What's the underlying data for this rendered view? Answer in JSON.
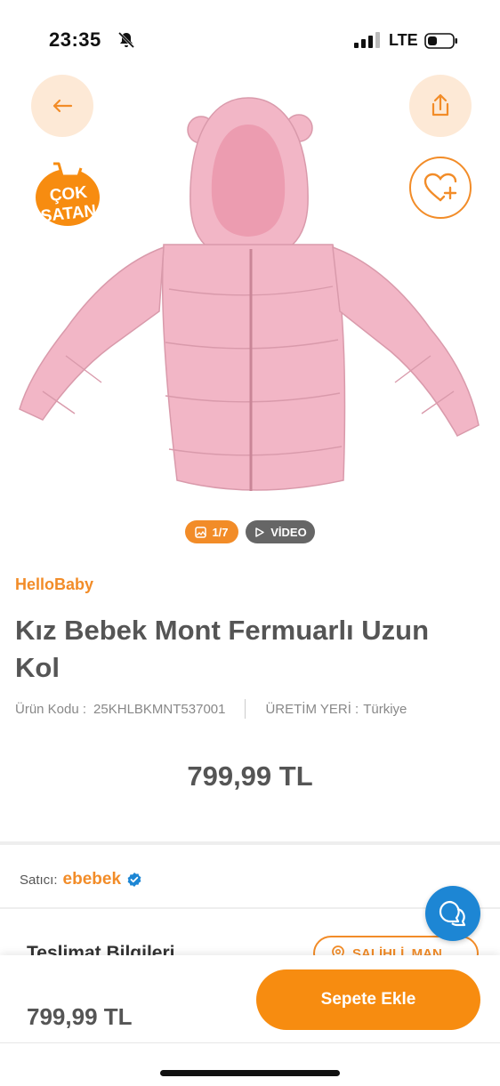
{
  "status_bar": {
    "time": "23:35",
    "network": "LTE"
  },
  "product": {
    "badge_line1": "ÇOK",
    "badge_line2": "SATAN",
    "gallery_counter": "1/7",
    "video_label": "VİDEO",
    "brand": "HelloBaby",
    "title": "Kız Bebek Mont Fermuarlı Uzun Kol",
    "code_label": "Ürün Kodu :",
    "code_value": "25KHLBKMNT537001",
    "origin_label": "ÜRETİM YERİ :",
    "origin_value": "Türkiye",
    "price": "799,99 TL",
    "jacket_color": "#f2b6c6"
  },
  "seller": {
    "label": "Satıcı:",
    "name": "ebebek"
  },
  "delivery": {
    "title": "Teslimat Bilgileri",
    "location": "SALİHLİ, MAN..."
  },
  "bottom_bar": {
    "price": "799,99 TL",
    "add_to_cart": "Sepete Ekle"
  },
  "colors": {
    "accent": "#f28c28",
    "cta": "#f78c10",
    "chat": "#1d86d4",
    "verified": "#1d86d4"
  },
  "icons": [
    "back-arrow-icon",
    "share-icon",
    "favorite-add-icon",
    "cart-icon",
    "image-icon",
    "play-icon",
    "verified-icon",
    "location-icon",
    "chat-icon",
    "bell-off-icon"
  ]
}
